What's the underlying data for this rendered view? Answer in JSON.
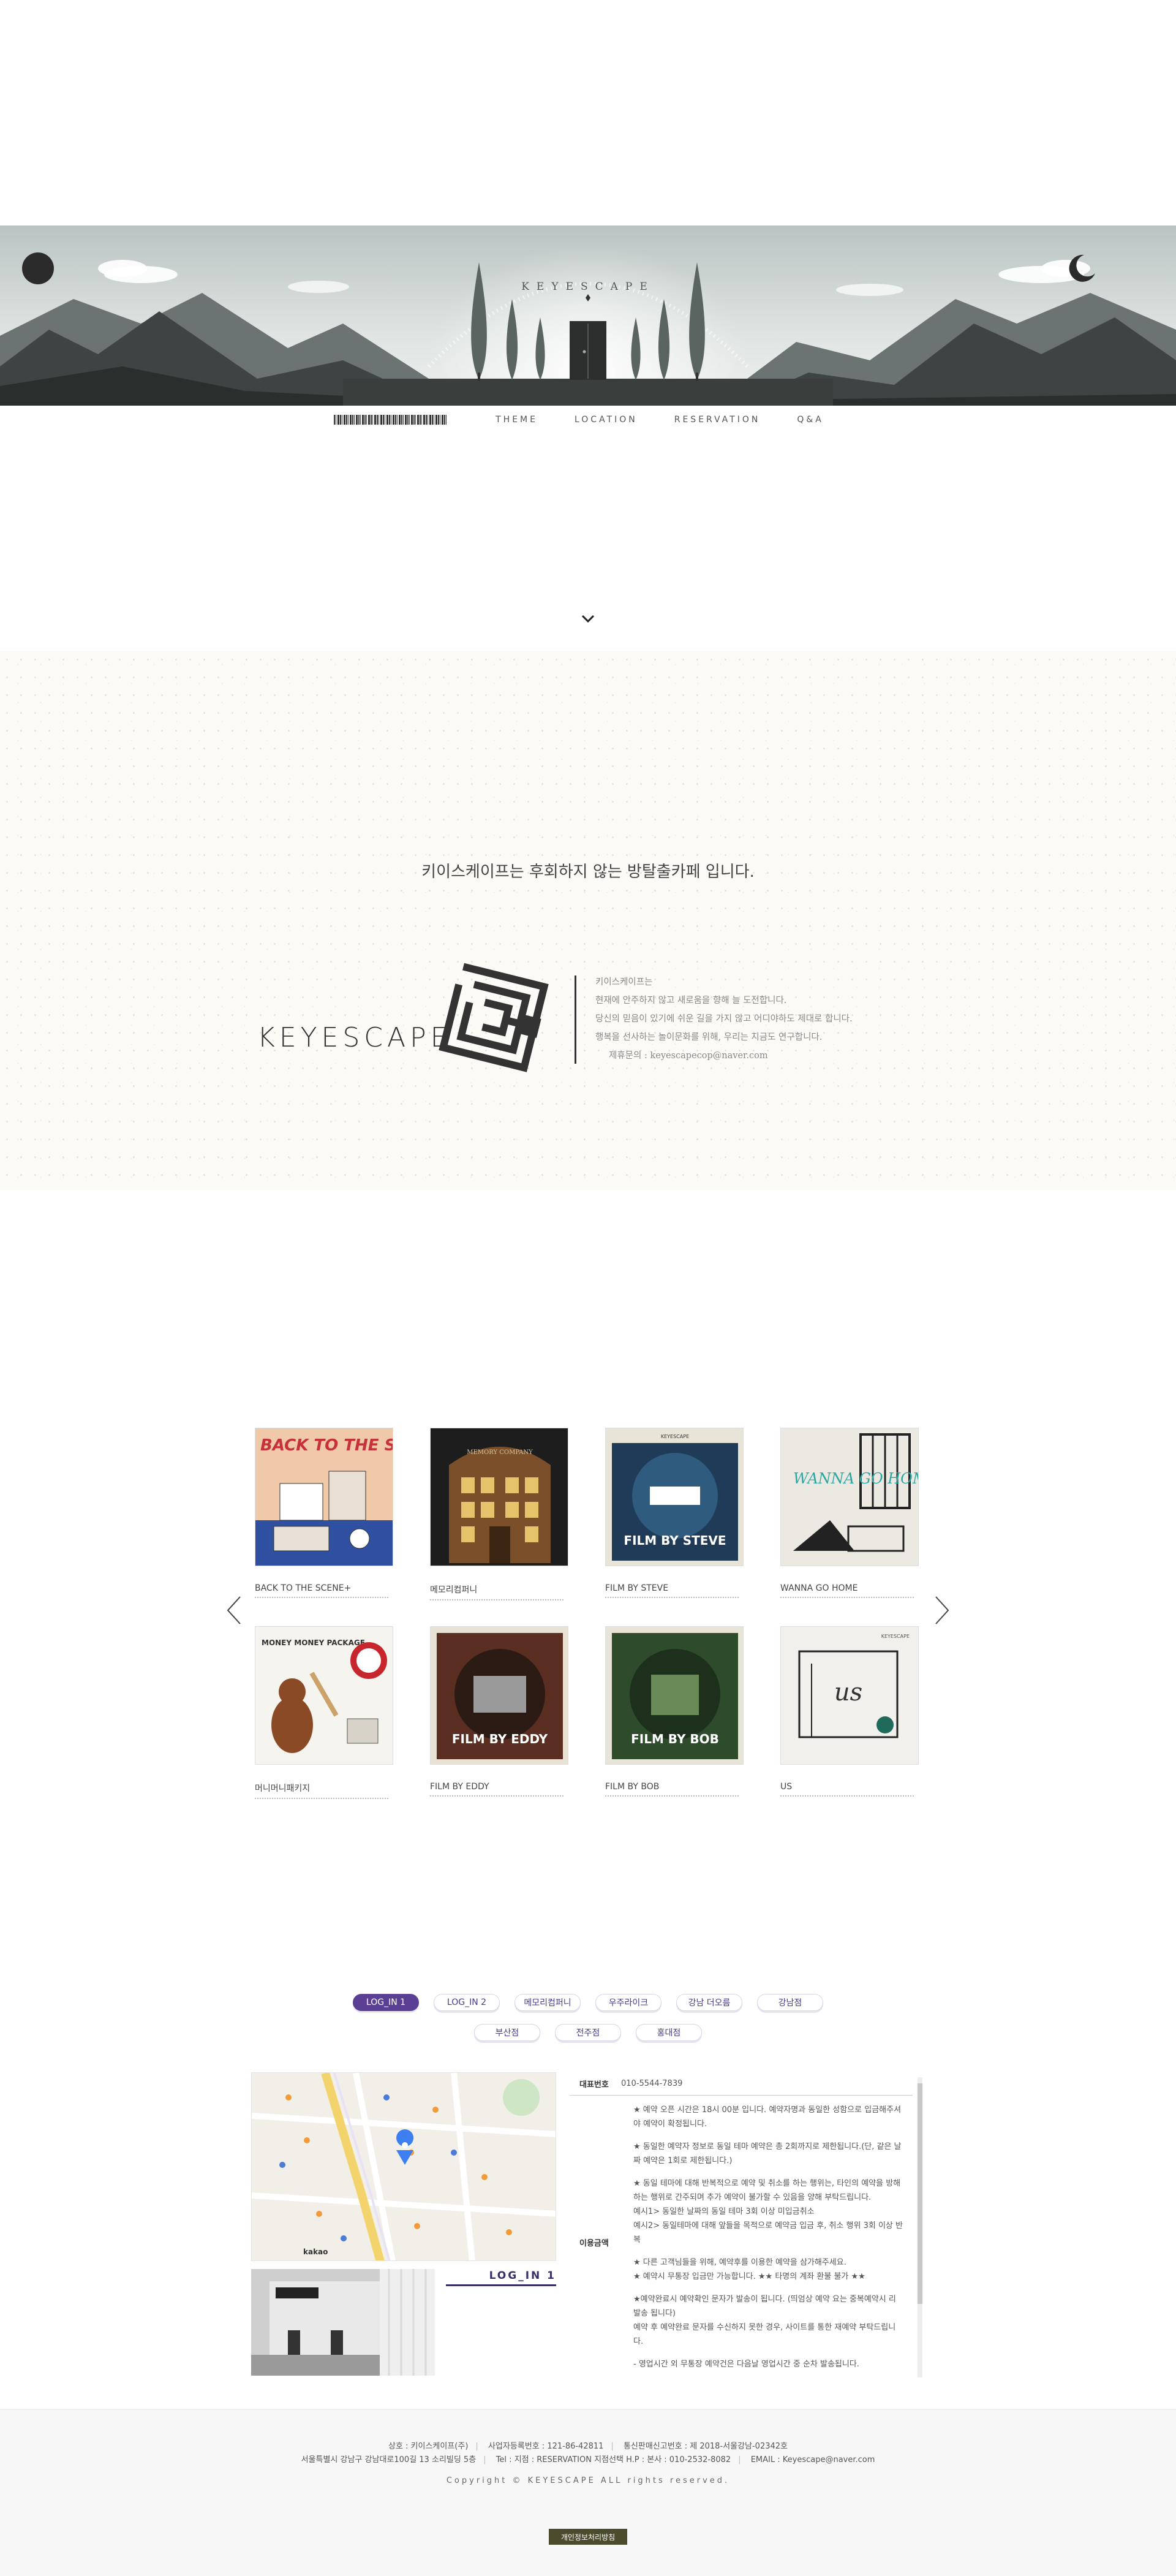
{
  "hero": {
    "title": "KEYESCAPE"
  },
  "nav": {
    "items": [
      "THEME",
      "LOCATION",
      "RESERVATION",
      "Q&A"
    ]
  },
  "intro": {
    "headline": "키이스케이프는 후회하지 않는 방탈출카페 입니다.",
    "brand": "KEYESCAPE",
    "lines": [
      "키이스케이프는",
      "현재에 안주하지 않고 새로움을 향해 늘 도전합니다.",
      "당신의 믿음이 있기에 쉬운 길을 가지 않고 어디야하도 제대로 합니다.",
      "행복을 선사하는 놀이문화를 위해, 우리는 지금도 연구합니다."
    ],
    "contact": "제휴문의 : keyescapecop@naver.com"
  },
  "themes": {
    "items": [
      {
        "label": "BACK TO THE SCENE+"
      },
      {
        "label": "메모리컴퍼니"
      },
      {
        "label": "FILM BY STEVE"
      },
      {
        "label": "WANNA GO HOME"
      },
      {
        "label": "머니머니패키지"
      },
      {
        "label": "FILM BY EDDY"
      },
      {
        "label": "FILM BY BOB"
      },
      {
        "label": "US"
      }
    ],
    "poster_text": {
      "back_title": "BACK TO THE SCENE+",
      "memory_sub": "MEMORY COMPANY",
      "steve": "FILM BY STEVE",
      "wanna": "WANNA GO HOME",
      "money": "MONEY MONEY PACKAGE",
      "eddy": "FILM BY EDDY",
      "bob": "FILM BY BOB",
      "us": "us",
      "brand_small": "KEYESCAPE"
    }
  },
  "branches": {
    "row1": [
      "LOG_IN 1",
      "LOG_IN 2",
      "메모리컴퍼니",
      "우주라이크",
      "강남 더오름",
      "강남점"
    ],
    "row2": [
      "부산점",
      "전주점",
      "홍대점"
    ],
    "active": "LOG_IN 1",
    "selected_name": "LOG_IN 1"
  },
  "info": {
    "phone_label": "대표번호",
    "phone": "010-5544-7839",
    "price_label": "이용금액",
    "notes": [
      "★ 예약 오픈 시간은 18시 00분 입니다. 예약자명과 동일한 성함으로 입금해주셔야 예약이 확정됩니다.",
      "★ 동일한 예약자 정보로 동일 테마 예약은 총 2회까지로 제한됩니다.(단, 같은 날짜 예약은 1회로 제한됩니다.)",
      "★ 동일 테마에 대해 반복적으로 예약 및 취소를 하는 행위는, 타인의 예약을 방해하는 행위로 간주되며 추가 예약이 불가할 수 있음을 양해 부탁드립니다.",
      "예시1> 동일한 날짜의 동일 테마 3회 이상 미입금취소",
      "예시2> 동일테마에 대해 앞들을 목적으로 예약금 입금 후, 취소 행위 3회 이상 반복",
      "★ 다른 고객님들을 위해, 예약후를 이용한 예약을 삼가해주세요.",
      "★ 예약시 무통장 입금만 가능합니다. ★★ 타명의 계좌 환불 불가 ★★",
      "★예약완료시 예약확인 문자가 발송이 됩니다. (띄엄상 예약 요는 중복예약시 리발송 됩니다)",
      "예약 후 예약완료 문자를 수신하지 못한 경우, 사이트를 통한 재예약 부탁드립니다.",
      "- 영업시간 외 무통장 예약건은 다음날 영업시간 중 순차 발송됩니다."
    ]
  },
  "footer": {
    "line1": [
      "상호 : 키이스케이프(주)",
      "사업자등록번호 : 121-86-42811",
      "통신판매신고번호 : 제 2018-서울강남-02342호"
    ],
    "line2": [
      "서울특별시 강남구 강남대로100길 13 소리빌딩 5층",
      "Tel : 지점 : RESERVATION 지점선택 H.P : 본사 : 010-2532-8082",
      "EMAIL : Keyescape@naver.com"
    ],
    "copyright": "Copyright © KEYESCAPE ALL rights reserved.",
    "privacy": "개인정보처리방침"
  },
  "map": {
    "kakao": "kakao"
  },
  "colors": {
    "accent": "#5a3f94",
    "footer_button": "#4b4b2e"
  }
}
